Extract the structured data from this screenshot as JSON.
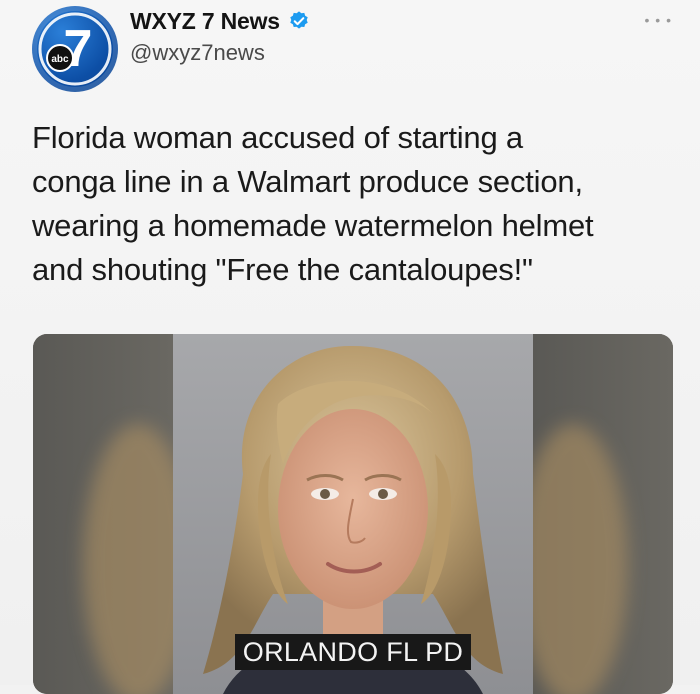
{
  "account": {
    "display_name": "WXYZ 7 News",
    "handle": "@wxyz7news",
    "avatar_badge": "abc",
    "avatar_number": "7",
    "verified": true
  },
  "tweet": {
    "text_lines": [
      "Florida woman accused of starting a",
      "conga line in a Walmart produce section,",
      "wearing a homemade watermelon helmet",
      "and shouting \"Free the cantaloupes!\""
    ]
  },
  "media": {
    "caption": "ORLANDO FL PD"
  },
  "colors": {
    "verified": "#1d9bf0",
    "avatar": "#0d4fa6",
    "background": "#f2f2f2"
  }
}
